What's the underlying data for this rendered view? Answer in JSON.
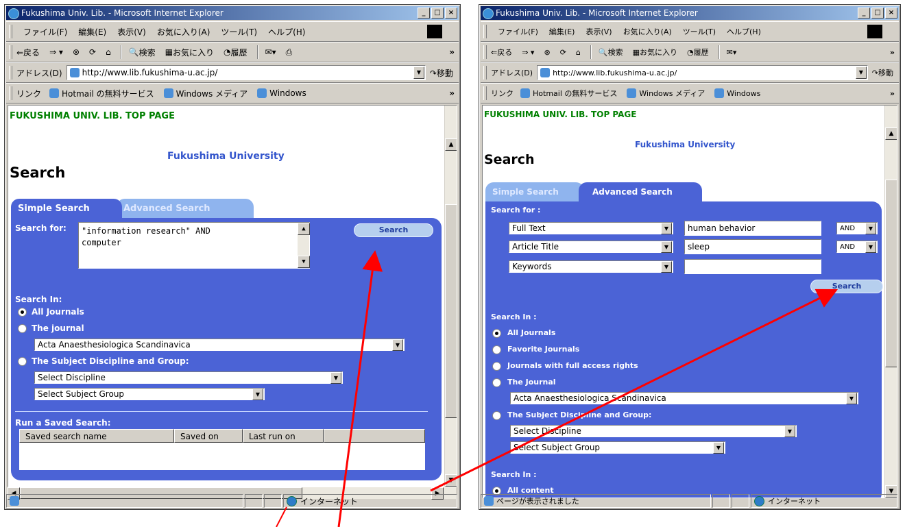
{
  "left_window": {
    "title": "Fukushima Univ. Lib. - Microsoft Internet Explorer",
    "menu": [
      "ファイル(F)",
      "編集(E)",
      "表示(V)",
      "お気に入り(A)",
      "ツール(T)",
      "ヘルプ(H)"
    ],
    "toolbar": {
      "back": "⇐戻る",
      "search": "検索",
      "favorites": "お気に入り",
      "history": "履歴"
    },
    "address": {
      "label": "アドレス(D)",
      "url": "http://www.lib.fukushima-u.ac.jp/",
      "go": "移動"
    },
    "links": {
      "label": "リンク",
      "items": [
        "Hotmail の無料サービス",
        "Windows メディア",
        "Windows"
      ]
    },
    "page": {
      "top_link": "FUKUSHIMA UNIV. LIB. TOP PAGE",
      "university": "Fukushima University",
      "heading": "Search",
      "tab_active": "Simple Search",
      "tab_inactive": "Advanced Search",
      "search_for_label": "Search for:",
      "query_line1": "\"information research\" AND",
      "query_line2": "computer",
      "search_button": "Search",
      "search_in_label": "Search In:",
      "options": [
        "All Journals",
        "The journal",
        "The Subject Discipline and Group:"
      ],
      "journal_select": "Acta Anaesthesiologica Scandinavica",
      "discipline_select": "Select Discipline",
      "group_select": "Select Subject Group",
      "saved_label": "Run a Saved Search:",
      "saved_columns": [
        "Saved search name",
        "Saved on",
        "Last run on"
      ]
    },
    "status": {
      "zone": "インターネット"
    }
  },
  "right_window": {
    "title": "Fukushima Univ. Lib. - Microsoft Internet Explorer",
    "menu": [
      "ファイル(F)",
      "編集(E)",
      "表示(V)",
      "お気に入り(A)",
      "ツール(T)",
      "ヘルプ(H)"
    ],
    "toolbar": {
      "back": "⇐戻る",
      "search": "検索",
      "favorites": "お気に入り",
      "history": "履歴"
    },
    "address": {
      "label": "アドレス(D)",
      "url": "http://www.lib.fukushima-u.ac.jp/",
      "go": "移動"
    },
    "links": {
      "label": "リンク",
      "items": [
        "Hotmail の無料サービス",
        "Windows メディア",
        "Windows"
      ]
    },
    "page": {
      "top_link": "FUKUSHIMA UNIV. LIB. TOP PAGE",
      "university": "Fukushima University",
      "heading": "Search",
      "tab_inactive": "Simple Search",
      "tab_active": "Advanced Search",
      "search_for_label": "Search for :",
      "rows": [
        {
          "field": "Full Text",
          "term": "human behavior",
          "op": "AND"
        },
        {
          "field": "Article Title",
          "term": "sleep",
          "op": "AND"
        },
        {
          "field": "Keywords",
          "term": ""
        }
      ],
      "search_button": "Search",
      "search_in_label": "Search In :",
      "options": [
        "All Journals",
        "Favorite Journals",
        "Journals with full access rights",
        "The Journal",
        "The Subject Discipline and Group:"
      ],
      "journal_select": "Acta Anaesthesiologica Scandinavica",
      "discipline_select": "Select Discipline",
      "group_select": "Select Subject Group",
      "search_in2_label": "Search In :",
      "content_option": "All content"
    },
    "status": {
      "message": "ページが表示されました",
      "zone": "インターネット"
    }
  },
  "colors": {
    "panel": "#4b63d6",
    "tab_active": "#4b63d6",
    "tab_inactive": "#8fb4ee",
    "arrow": "#ff0000",
    "top_link": "#008000"
  }
}
